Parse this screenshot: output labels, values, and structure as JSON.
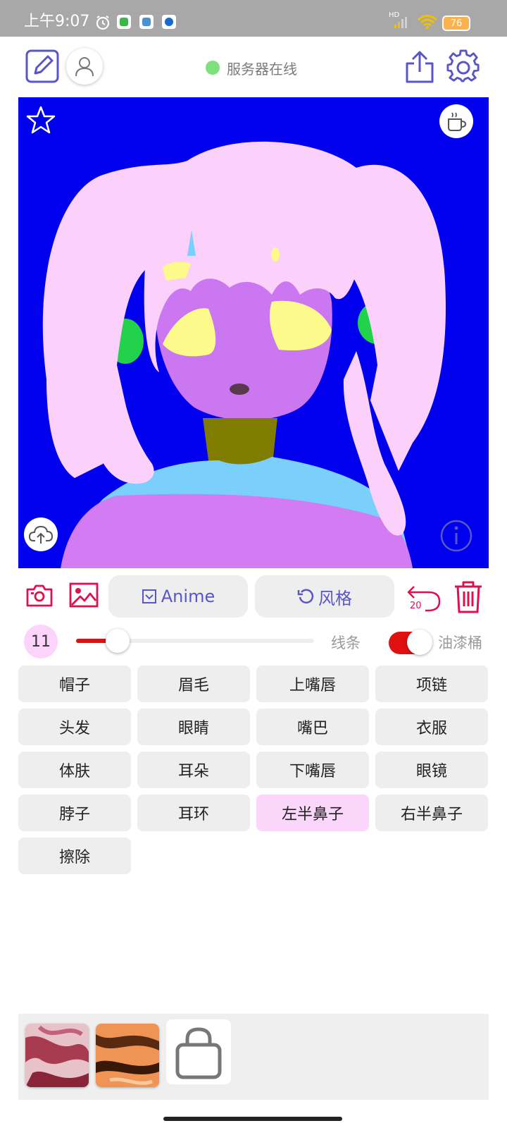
{
  "status_bar": {
    "time": "上午9:07",
    "network": "HD",
    "battery": "76",
    "notification_icons": [
      "alarm-icon",
      "wechat-icon",
      "gallery-icon",
      "app-icon"
    ]
  },
  "toolbar": {
    "left_icons": [
      "edit-icon",
      "user-icon"
    ],
    "right_icons": [
      "share-icon",
      "settings-icon"
    ],
    "server_status": "服务器在线",
    "server_status_color": "#7ee17e"
  },
  "canvas": {
    "background_color": "#0000ef",
    "corner_icons": [
      "star-icon",
      "coffee-icon",
      "upload-cloud-icon",
      "info-icon"
    ]
  },
  "tools": {
    "anime_label": "Anime",
    "style_label": "风格",
    "undo_count": "20",
    "icons": [
      "camera-icon",
      "image-icon",
      "undo-icon",
      "trash-icon"
    ]
  },
  "brush": {
    "size": "11",
    "slider_fraction": 0.17,
    "line_label": "线条",
    "bucket_label": "油漆桶",
    "bucket_enabled": true,
    "accent": "#e01010"
  },
  "parts": [
    "帽子",
    "眉毛",
    "上嘴唇",
    "项链",
    "头发",
    "眼睛",
    "嘴巴",
    "衣服",
    "体肤",
    "耳朵",
    "下嘴唇",
    "眼镜",
    "脖子",
    "耳环",
    "左半鼻子",
    "右半鼻子",
    "擦除"
  ],
  "selected_part": "左半鼻子",
  "tray": {
    "icons": [
      "style-thumbnail-red",
      "style-thumbnail-orange",
      "shop-bag-icon"
    ]
  }
}
